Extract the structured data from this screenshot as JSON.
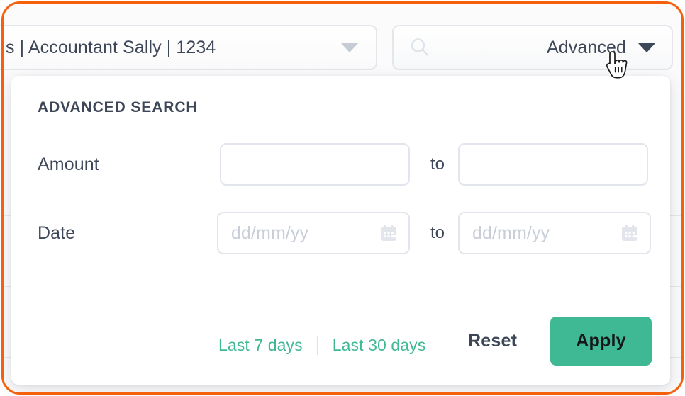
{
  "frame": {
    "accent_color": "#f4600b"
  },
  "topbar": {
    "select": {
      "value": "s | Accountant Sally | 1234",
      "chevron_icon": "chevron-down-icon"
    },
    "search": {
      "icon": "search-icon",
      "placeholder": "",
      "advanced_label": "Advanced",
      "chevron_icon": "chevron-down-icon"
    }
  },
  "popover": {
    "title": "ADVANCED SEARCH",
    "rows": [
      {
        "label": "Amount",
        "from_placeholder": "",
        "to_word": "to",
        "to_placeholder": ""
      },
      {
        "label": "Date",
        "from_placeholder": "dd/mm/yy",
        "to_word": "to",
        "to_placeholder": "dd/mm/yy",
        "icon": "calendar-icon"
      }
    ],
    "quick_ranges": [
      {
        "label": "Last 7 days"
      },
      {
        "label": "Last 30 days"
      }
    ],
    "actions": {
      "reset_label": "Reset",
      "apply_label": "Apply",
      "apply_color": "#3fb894"
    }
  },
  "cursor": {
    "type": "pointer-hand-cursor"
  }
}
